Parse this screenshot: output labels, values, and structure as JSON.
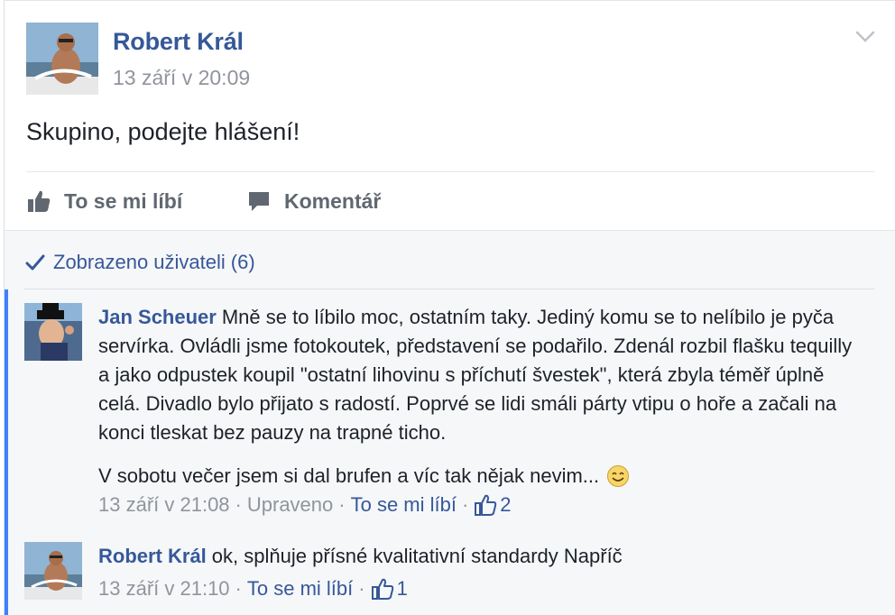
{
  "post": {
    "author": "Robert Král",
    "timestamp": "13 září v 20:09",
    "text": "Skupino, podejte hlášení!",
    "like_label": "To se mi líbí",
    "comment_label": "Komentář"
  },
  "seen": {
    "label": "Zobrazeno uživateli",
    "count": "(6)"
  },
  "comments": [
    {
      "author": "Jan Scheuer",
      "text": "Mně se to líbilo moc, ostatním taky. Jediný komu se to nelíbilo je pyča servírka. Ovládli jsme fotokoutek, představení se podařilo. Zdenál rozbil flašku tequilly a jako odpustek koupil \"ostatní lihovinu s příchutí švestek\", která zbyla téměř úplně celá. Divadlo bylo přijato s radostí. Poprvé se lidi smáli párty vtipu o hoře a začali na konci tleskat bez pauzy na trapné ticho.",
      "text2": "V sobotu večer jsem si dal brufen a víc tak nějak nevim...",
      "timestamp": "13 září v 21:08",
      "edited": "Upraveno",
      "like_link": "To se mi líbí",
      "like_count": "2"
    },
    {
      "author": "Robert Král",
      "text": "ok, splňuje přísné kvalitativní standardy Napříč",
      "timestamp": "13 září v 21:10",
      "like_link": "To se mi líbí",
      "like_count": "1"
    }
  ],
  "colors": {
    "link": "#365899",
    "meta": "#90949c",
    "accent": "#4080ff"
  },
  "icons": [
    "chevron-down-icon",
    "thumbs-up-icon",
    "comment-bubble-icon",
    "checkmark-icon",
    "smiley-icon"
  ]
}
